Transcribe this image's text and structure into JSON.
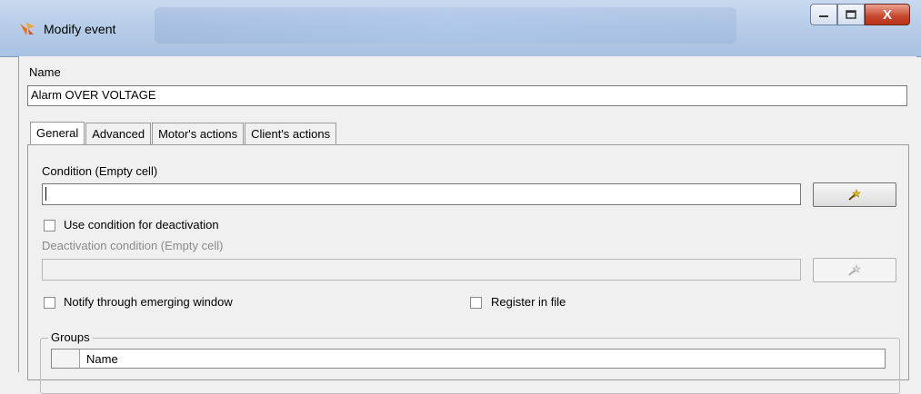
{
  "window": {
    "title": "Modify event",
    "close_glyph": "X"
  },
  "name_field": {
    "label": "Name",
    "value": "Alarm OVER VOLTAGE"
  },
  "tabs": [
    {
      "label": "General",
      "active": true
    },
    {
      "label": "Advanced",
      "active": false
    },
    {
      "label": "Motor's actions",
      "active": false
    },
    {
      "label": "Client's actions",
      "active": false
    }
  ],
  "general": {
    "condition_label": "Condition (Empty cell)",
    "condition_value": "",
    "use_condition_label": "Use condition for deactivation",
    "use_condition_checked": false,
    "deactivation_label": "Deactivation condition (Empty cell)",
    "deactivation_value": "",
    "notify_label": "Notify through emerging window",
    "notify_checked": false,
    "register_label": "Register in file",
    "register_checked": false,
    "groups_label": "Groups",
    "groups_columns": [
      "Name"
    ]
  },
  "icons": {
    "app": "event-app-icon",
    "edit_button": "wand-icon"
  }
}
